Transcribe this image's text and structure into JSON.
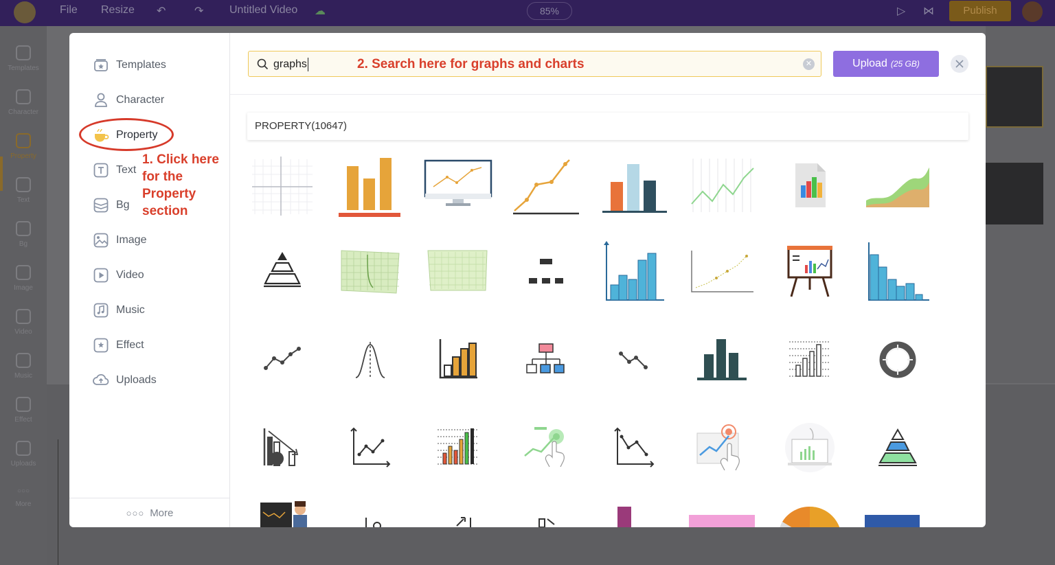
{
  "topbar": {
    "file": "File",
    "resize": "Resize",
    "title": "Untitled Video",
    "zoom": "85%",
    "publish": "Publish"
  },
  "rail": [
    {
      "label": "Templates"
    },
    {
      "label": "Character"
    },
    {
      "label": "Property"
    },
    {
      "label": "Text"
    },
    {
      "label": "Bg"
    },
    {
      "label": "Image"
    },
    {
      "label": "Video"
    },
    {
      "label": "Music"
    },
    {
      "label": "Effect"
    },
    {
      "label": "Uploads"
    },
    {
      "label": "More"
    }
  ],
  "sidebar": {
    "items": [
      {
        "label": "Templates",
        "icon": "templates-icon"
      },
      {
        "label": "Character",
        "icon": "character-icon"
      },
      {
        "label": "Property",
        "icon": "property-icon",
        "active": true
      },
      {
        "label": "Text",
        "icon": "text-icon"
      },
      {
        "label": "Bg",
        "icon": "bg-icon"
      },
      {
        "label": "Image",
        "icon": "image-icon"
      },
      {
        "label": "Video",
        "icon": "video-icon"
      },
      {
        "label": "Music",
        "icon": "music-icon"
      },
      {
        "label": "Effect",
        "icon": "effect-icon"
      },
      {
        "label": "Uploads",
        "icon": "uploads-icon"
      }
    ],
    "more_label": "More"
  },
  "annotations": {
    "note1_line1": "1. Click here for the",
    "note1_line2": "Property section",
    "note2": "2. Search here for graphs and charts",
    "accent": "#d93f2b"
  },
  "search": {
    "value": "graphs",
    "placeholder": ""
  },
  "upload": {
    "label": "Upload",
    "size": "(25 GB)"
  },
  "results": {
    "header": "PROPERTY(10647)",
    "items": [
      "grid-axes",
      "orange-bar-chart",
      "monitor-line-chart",
      "orange-line-chart",
      "color-bar-chart",
      "green-line-chart",
      "document-chart",
      "area-chart",
      "pyramid-outline",
      "paper-graph",
      "paper-grid",
      "hierarchy-dots",
      "blue-bar-chart",
      "dot-trend-chart",
      "easel-presentation",
      "blue-histogram",
      "line-graph-icon",
      "bell-curve",
      "bar-chart-outline",
      "org-chart",
      "line-down-icon",
      "dark-bar-chart",
      "dotted-bar-chart",
      "donut-chart",
      "decline-chart",
      "line-axes-icon",
      "color-bars-grid",
      "touch-growth",
      "line-down-axes",
      "touch-graph",
      "laptop-chart",
      "color-pyramid",
      "presenter-chart",
      "axis-partial",
      "arrow-partial",
      "flow-partial",
      "purple-bar",
      "pink-rect",
      "pie-chart",
      "blue-rect"
    ]
  },
  "colors": {
    "brand": "#8e6ee0",
    "search_border": "#efc95a",
    "orange": "#e6a43a",
    "blue": "#4fb3d9",
    "dark_teal": "#2f4f52"
  }
}
